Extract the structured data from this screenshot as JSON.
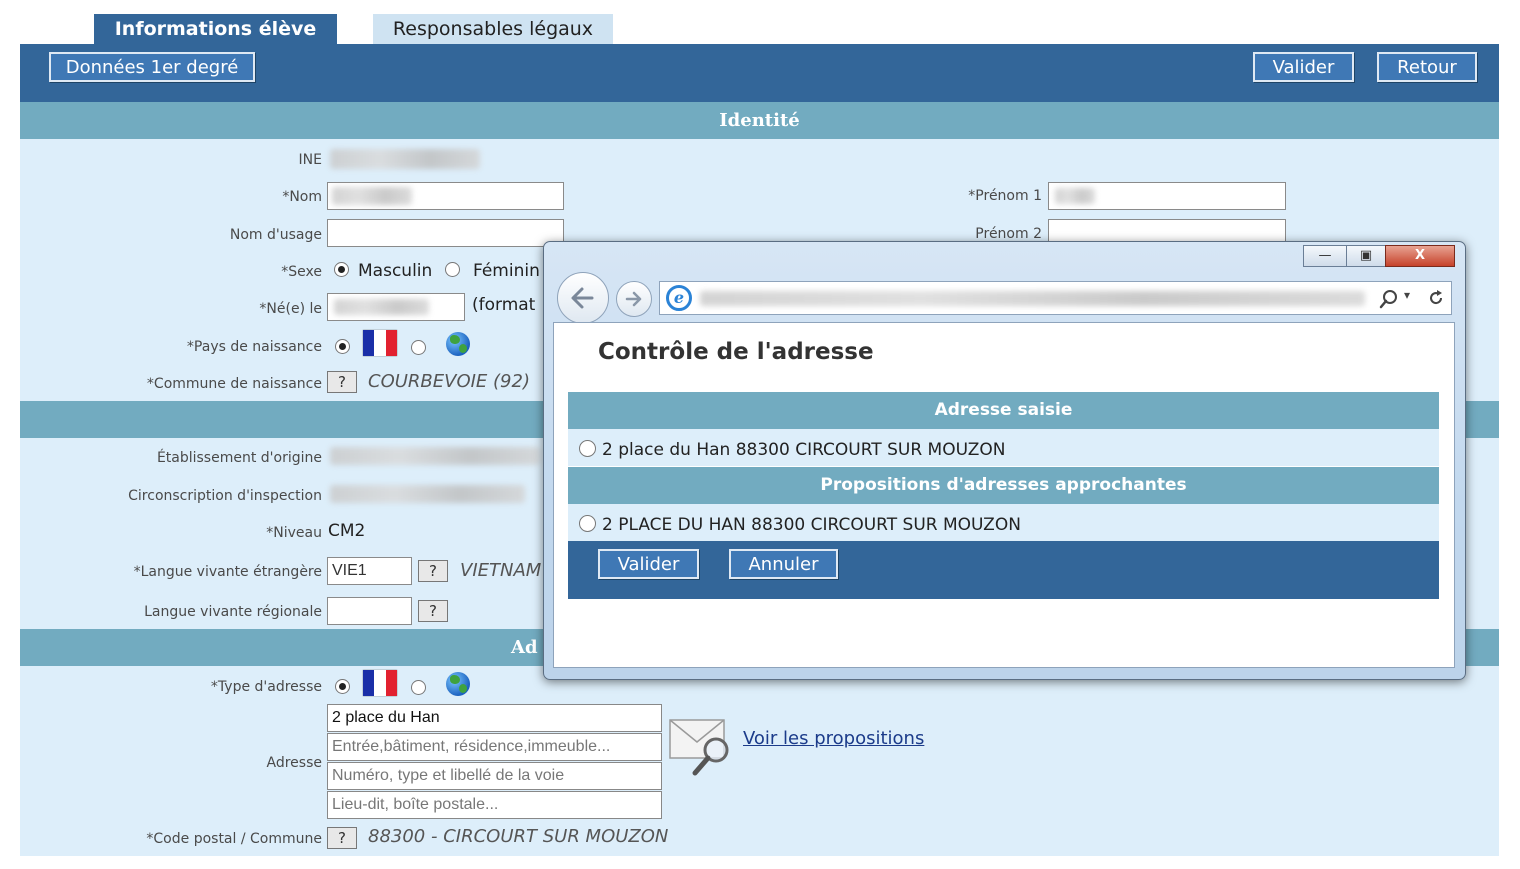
{
  "tabs": [
    {
      "label": "Informations élève",
      "active": true
    },
    {
      "label": "Responsables légaux",
      "active": false
    }
  ],
  "toolbar": {
    "donnees_label": "Données 1er degré",
    "valider_label": "Valider",
    "retour_label": "Retour"
  },
  "identite": {
    "section_title": "Identité",
    "ine_label": "INE",
    "nom_label": "*Nom",
    "prenom1_label": "*Prénom 1",
    "nom_usage_label": "Nom d'usage",
    "prenom2_label": "Prénom 2",
    "sexe_label": "*Sexe",
    "sexe_masculin": "Masculin",
    "sexe_feminin": "Féminin",
    "ne_le_label": "*Né(e) le",
    "format_hint": "(format",
    "pays_label": "*Pays de naissance",
    "commune_label": "*Commune de naissance",
    "commune_value": "COURBEVOIE (92)"
  },
  "scolarite": {
    "etab_label": "Établissement d'origine",
    "circ_label": "Circonscription d'inspection",
    "niveau_label": "*Niveau",
    "niveau_value": "CM2",
    "lve_label": "*Langue vivante étrangère",
    "lve_code": "VIE1",
    "lve_value": "VIETNAM",
    "lvr_label": "Langue vivante régionale"
  },
  "adresse": {
    "section_title_visible": "Ad",
    "type_label": "*Type d'adresse",
    "adresse_label": "Adresse",
    "line1": "2 place du Han",
    "line2_placeholder": "Entrée,bâtiment, résidence,immeuble...",
    "line3_placeholder": "Numéro, type et libellé de la voie",
    "line4_placeholder": "Lieu-dit, boîte postale...",
    "voir_link": "Voir les propositions",
    "cp_label": "*Code postal / Commune",
    "cp_value": "88300 - CIRCOURT SUR MOUZON"
  },
  "common": {
    "help_q": "?"
  },
  "popup": {
    "title": "Contrôle de l'adresse",
    "saisie_header": "Adresse saisie",
    "saisie_option": "2 place du Han 88300 CIRCOURT SUR MOUZON",
    "propositions_header": "Propositions d'adresses approchantes",
    "proposition_option": "2 PLACE DU HAN 88300 CIRCOURT SUR MOUZON",
    "valider_label": "Valider",
    "annuler_label": "Annuler",
    "win_minimize": "—",
    "win_restore": "▣",
    "win_close": "X"
  },
  "colors": {
    "primary": "#336699",
    "section": "#72abc0",
    "panel": "#ddeefa"
  }
}
